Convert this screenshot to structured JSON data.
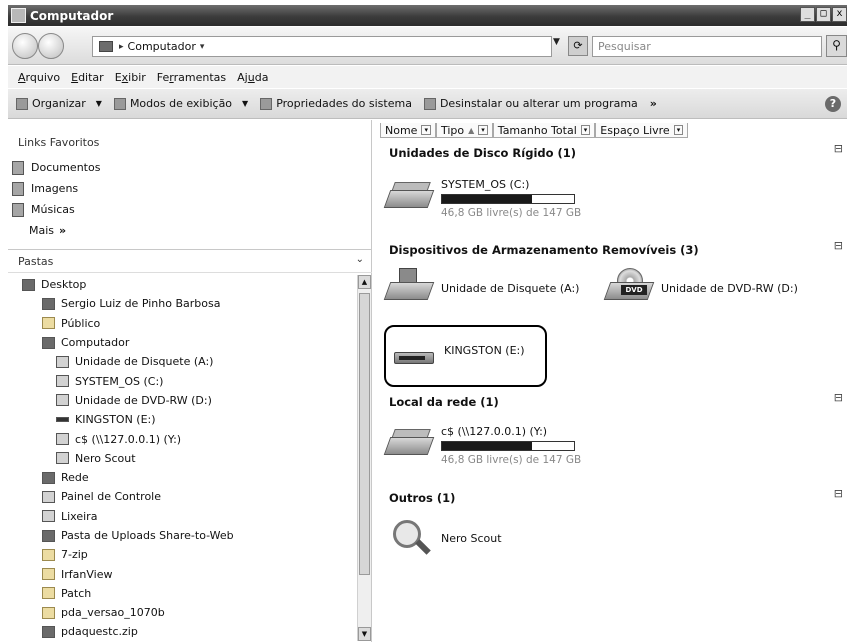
{
  "window": {
    "title": "Computador",
    "controls": {
      "minimize": "_",
      "maximize": "□",
      "close": "x"
    }
  },
  "addressbar": {
    "path_text": "Computador",
    "separator_arrow": "▸",
    "path_dropdown": "▾",
    "dropdown_arrow": "▼",
    "search_placeholder": "Pesquisar"
  },
  "menubar": {
    "items": [
      {
        "pre": "",
        "u": "A",
        "post": "rquivo"
      },
      {
        "pre": "",
        "u": "E",
        "post": "ditar"
      },
      {
        "pre": "E",
        "u": "x",
        "post": "ibir"
      },
      {
        "pre": "Fe",
        "u": "r",
        "post": "ramentas"
      },
      {
        "pre": "Aj",
        "u": "u",
        "post": "da"
      }
    ]
  },
  "commandbar": {
    "organize": "Organizar",
    "view_modes": "Modos de exibição",
    "system_properties": "Propriedades do sistema",
    "uninstall": "Desinstalar ou alterar um programa",
    "more": "»",
    "dd": "▼",
    "help": "?"
  },
  "favorites": {
    "title": "Links Favoritos",
    "items": [
      "Documentos",
      "Imagens",
      "Músicas"
    ],
    "more_label": "Mais",
    "more_glyph": "»"
  },
  "folders": {
    "title": "Pastas",
    "chevron": "⌄",
    "tree": [
      {
        "label": "Desktop"
      },
      {
        "label": "Sergio Luiz de Pinho Barbosa"
      },
      {
        "label": "Público"
      },
      {
        "label": "Computador"
      },
      {
        "label": "Unidade de Disquete (A:)"
      },
      {
        "label": "SYSTEM_OS (C:)"
      },
      {
        "label": "Unidade de DVD-RW (D:)"
      },
      {
        "label": "KINGSTON (E:)"
      },
      {
        "label": "c$ (\\\\127.0.0.1) (Y:)"
      },
      {
        "label": "Nero Scout"
      },
      {
        "label": "Rede"
      },
      {
        "label": "Painel de Controle"
      },
      {
        "label": "Lixeira"
      },
      {
        "label": "Pasta de Uploads Share-to-Web"
      },
      {
        "label": "7-zip"
      },
      {
        "label": "IrfanView"
      },
      {
        "label": "Patch"
      },
      {
        "label": "pda_versao_1070b"
      },
      {
        "label": "pdaquestc.zip"
      }
    ],
    "scroll_up": "▲",
    "scroll_down": "▼"
  },
  "columns": {
    "name": "Nome",
    "type": "Tipo",
    "total_size": "Tamanho Total",
    "free_space": "Espaço Livre",
    "dd": "▾",
    "sort": "▲"
  },
  "groups": {
    "hdd": "Unidades de Disco Rígido (1)",
    "removable": "Dispositivos de Armazenamento Removíveis (3)",
    "network": "Local da rede (1)",
    "others": "Outros (1)",
    "collapse_glyph": "⊟"
  },
  "drives": {
    "system": {
      "name": "SYSTEM_OS (C:)",
      "free": "46,8 GB livre(s) de 147 GB",
      "used_fraction": 0.68
    },
    "floppy": {
      "name": "Unidade de Disquete (A:)"
    },
    "dvd": {
      "name": "Unidade de DVD-RW (D:)",
      "badge": "DVD"
    },
    "kingston": {
      "name": "KINGSTON (E:)"
    },
    "network": {
      "name": "c$ (\\\\127.0.0.1) (Y:)",
      "free": "46,8 GB livre(s) de 147 GB",
      "used_fraction": 0.68
    },
    "nero": {
      "name": "Nero Scout"
    }
  }
}
